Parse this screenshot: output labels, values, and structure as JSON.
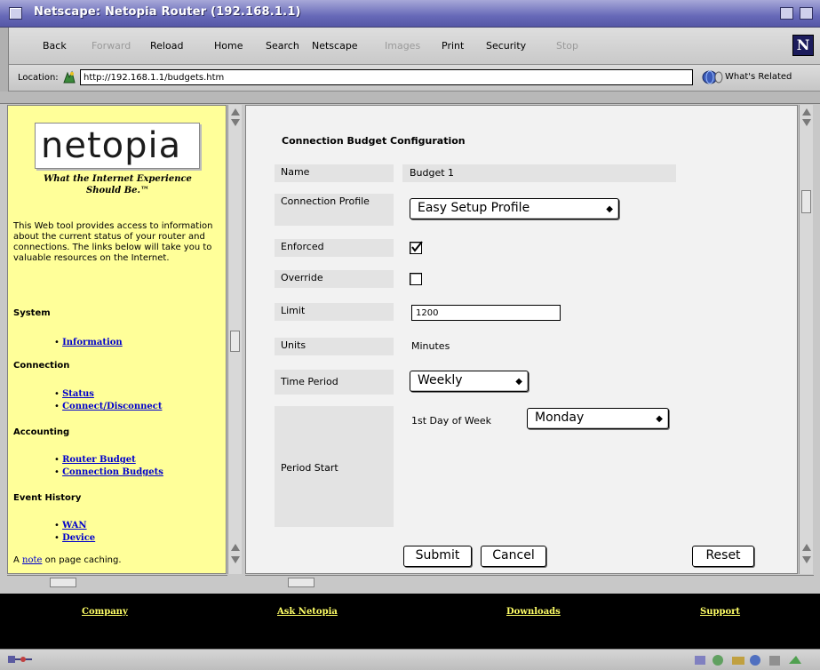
{
  "window": {
    "title": "Netscape: Netopia Router (192.168.1.1)"
  },
  "toolbar": {
    "buttons": [
      {
        "label": "Back",
        "enabled": true
      },
      {
        "label": "Forward",
        "enabled": false
      },
      {
        "label": "Reload",
        "enabled": true
      },
      {
        "label": "Home",
        "enabled": true
      },
      {
        "label": "Search",
        "enabled": true
      },
      {
        "label": "Netscape",
        "enabled": true
      },
      {
        "label": "Images",
        "enabled": false
      },
      {
        "label": "Print",
        "enabled": true
      },
      {
        "label": "Security",
        "enabled": true
      },
      {
        "label": "Stop",
        "enabled": false
      }
    ],
    "brand_letter": "N"
  },
  "location": {
    "label": "Location:",
    "url": "http://192.168.1.1/budgets.htm",
    "related": "What's Related"
  },
  "sidebar": {
    "logo": "netopia",
    "tagline_line1": "What the Internet Experience",
    "tagline_line2": "Should Be.™",
    "intro": "This Web tool provides access to information about the current status of your router and connections. The links below will take you to valuable resources on the Internet.",
    "sections": [
      {
        "heading": "System",
        "links": [
          "Information"
        ]
      },
      {
        "heading": "Connection",
        "links": [
          "Status",
          "Connect/Disconnect"
        ]
      },
      {
        "heading": "Accounting",
        "links": [
          "Router Budget",
          "Connection Budgets"
        ]
      },
      {
        "heading": "Event History",
        "links": [
          "WAN",
          "Device"
        ]
      }
    ],
    "cache_prefix": "A",
    "cache_link": "note",
    "cache_suffix": "on page caching."
  },
  "form": {
    "title": "Connection Budget Configuration",
    "name_label": "Name",
    "name_value": "Budget 1",
    "profile_label": "Connection Profile",
    "profile_value": "Easy Setup Profile",
    "enforced_label": "Enforced",
    "enforced_checked": true,
    "override_label": "Override",
    "override_checked": false,
    "limit_label": "Limit",
    "limit_value": "1200",
    "units_label": "Units",
    "units_value": "Minutes",
    "period_label": "Time Period",
    "period_value": "Weekly",
    "start_label": "Period Start",
    "first_day_label": "1st Day of Week",
    "first_day_value": "Monday",
    "submit": "Submit",
    "cancel": "Cancel",
    "reset": "Reset"
  },
  "footer": {
    "links": [
      "Company",
      "Ask Netopia",
      "Downloads",
      "Support"
    ]
  }
}
